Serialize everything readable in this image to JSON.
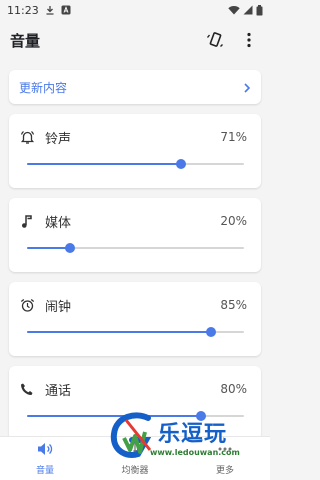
{
  "status_bar": {
    "time": "11:23"
  },
  "app_bar": {
    "title": "音量"
  },
  "update": {
    "label": "更新内容"
  },
  "volumes": [
    {
      "label": "铃声",
      "value_text": "71%",
      "level": 0.71
    },
    {
      "label": "媒体",
      "value_text": "20%",
      "level": 0.2
    },
    {
      "label": "闹钟",
      "value_text": "85%",
      "level": 0.85
    },
    {
      "label": "通话",
      "value_text": "80%",
      "level": 0.8
    }
  ],
  "bottom_nav": [
    {
      "label": "音量",
      "icon": "volume-icon",
      "active": true
    },
    {
      "label": "均衡器",
      "icon": "equalizer-icon",
      "active": false
    },
    {
      "label": "更多",
      "icon": "more-icon",
      "active": false
    }
  ],
  "watermark": {
    "text": "乐逗玩",
    "url": "www.ledouwan.com"
  },
  "colors": {
    "accent": "#4a79e8",
    "track": "#d6d6d6",
    "background": "#f4f4f4"
  }
}
